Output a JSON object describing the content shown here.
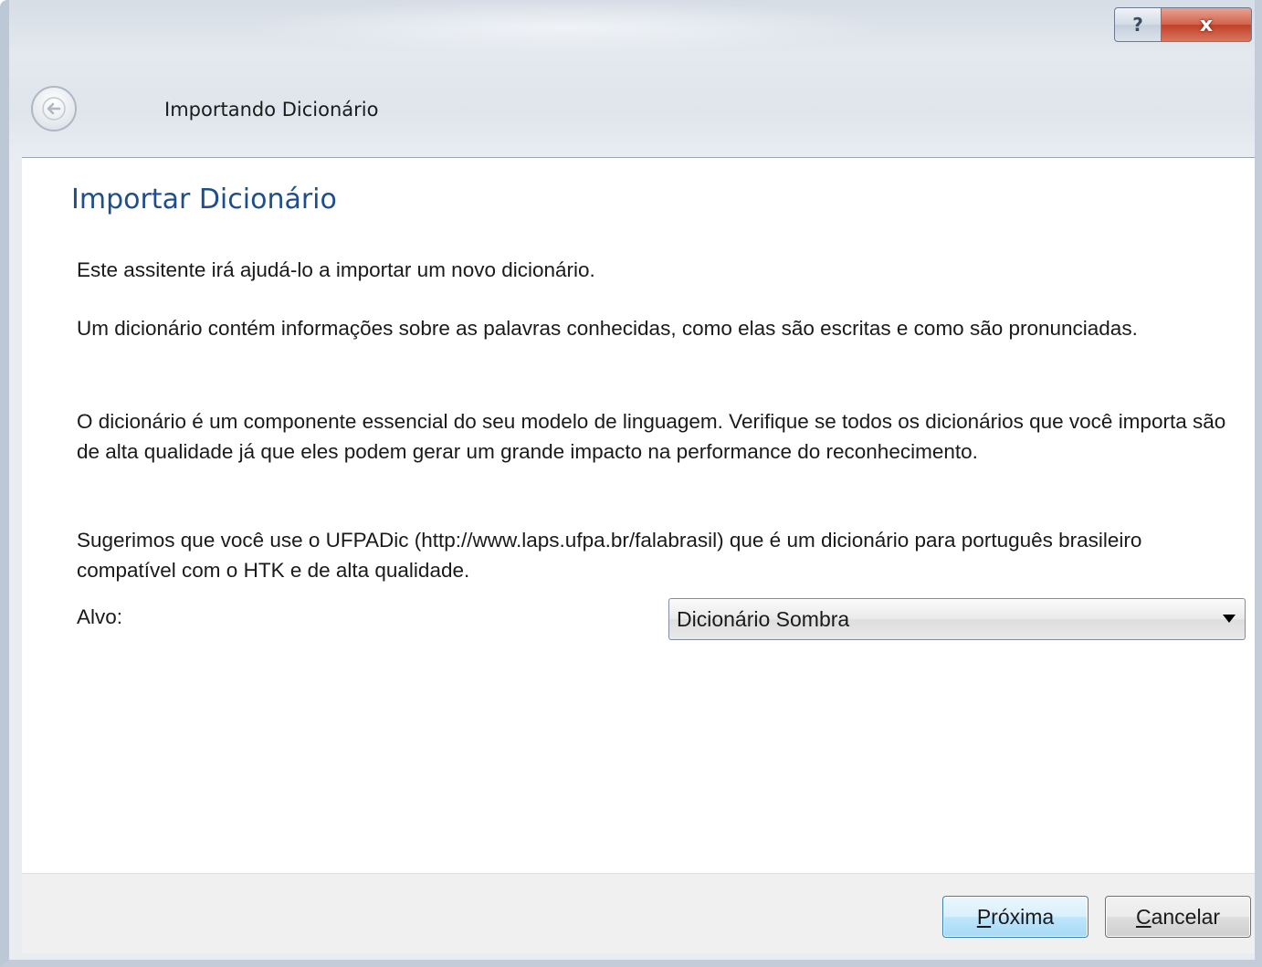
{
  "window": {
    "caption_help": "?",
    "caption_close": "x"
  },
  "header": {
    "title": "Importando Dicionário"
  },
  "page": {
    "heading": "Importar Dicionário",
    "paragraphs": [
      "Este assitente irá ajudá-lo a importar um novo dicionário.",
      "Um dicionário contém informações sobre as palavras conhecidas, como elas são escritas e como são pronunciadas.",
      "O dicionário é um componente essencial do seu modelo de linguagem. Verifique se todos os dicionários que você importa são de alta qualidade já que eles podem  gerar um grande impacto na performance do reconhecimento.",
      "Sugerimos que você use o UFPADic (http://www.laps.ufpa.br/falabrasil) que é um dicionário para português brasileiro compatível com o HTK e de alta qualidade."
    ],
    "target_label": "Alvo:",
    "target_value": "Dicionário Sombra"
  },
  "footer": {
    "next_mnemonic": "P",
    "next_rest": "róxima",
    "cancel_mnemonic": "C",
    "cancel_rest": "ancelar"
  },
  "colors": {
    "heading": "#1e4e8c",
    "next_button_border": "#3c7fb1",
    "close_button": "#c13f26"
  },
  "icons": {
    "back": "back-arrow-icon",
    "dropdown": "chevron-down-icon"
  }
}
